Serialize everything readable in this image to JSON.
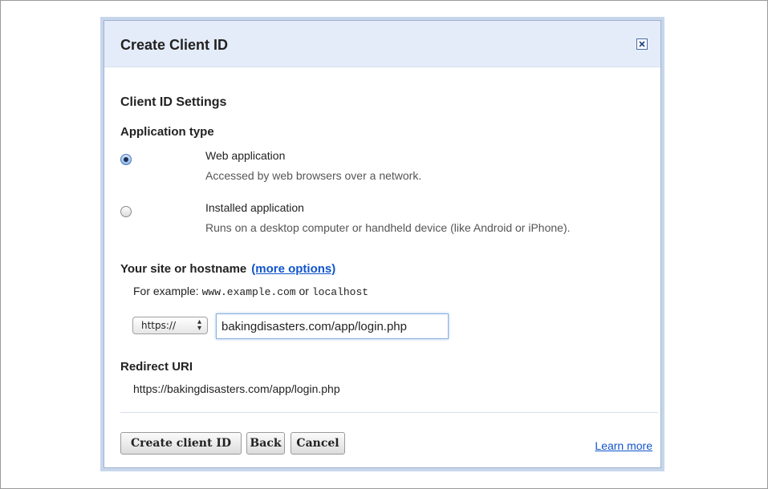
{
  "dialog": {
    "title": "Create Client ID",
    "close_icon": "close-icon"
  },
  "settings": {
    "section_title": "Client ID Settings",
    "app_type_label": "Application type",
    "options": [
      {
        "label": "Web application",
        "description": "Accessed by web browsers over a network.",
        "selected": true
      },
      {
        "label": "Installed application",
        "description": "Runs on a desktop computer or handheld device (like Android or iPhone).",
        "selected": false
      }
    ]
  },
  "hostname": {
    "label": "Your site or hostname",
    "more_options": "(more options)",
    "example_prefix": "For example:",
    "example_1": "www.example.com",
    "example_or": "or",
    "example_2": "localhost",
    "scheme": "https://",
    "value": "bakingdisasters.com/app/login.php"
  },
  "redirect": {
    "label": "Redirect URI",
    "value": "https://bakingdisasters.com/app/login.php"
  },
  "buttons": {
    "create": "Create client ID",
    "back": "Back",
    "cancel": "Cancel",
    "learn_more": "Learn more"
  },
  "colors": {
    "dialog_border": "#c7d6ea",
    "title_bar": "#e5ecf9",
    "link": "#1155cc"
  }
}
